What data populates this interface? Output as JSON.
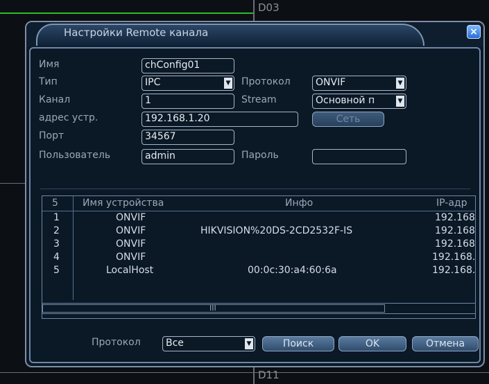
{
  "background": {
    "top_label": "D03",
    "bottom_label": "D11"
  },
  "dialog": {
    "title": "Настройки Remote канала",
    "close_glyph": "×"
  },
  "form": {
    "name_label": "Имя",
    "name_value": "chConfig01",
    "type_label": "Тип",
    "type_value": "IPC",
    "protocol_label": "Протокол",
    "protocol_value": "ONVIF",
    "channel_label": "Канал",
    "channel_value": "1",
    "stream_label": "Stream",
    "stream_value": "Основной п",
    "address_label": "адрес устр.",
    "address_value": "192.168.1.20",
    "network_button": "Сеть",
    "port_label": "Порт",
    "port_value": "34567",
    "user_label": "Пользователь",
    "user_value": "admin",
    "password_label": "Пароль",
    "password_value": ""
  },
  "device_list": {
    "headers": {
      "count": "5",
      "device_name": "Имя устройства",
      "info": "Инфо",
      "ip": "IP-адр"
    },
    "rows": [
      {
        "num": "1",
        "name": "ONVIF",
        "info": "",
        "ip": "192.168"
      },
      {
        "num": "2",
        "name": "ONVIF",
        "info": "HIKVISION%20DS-2CD2532F-IS",
        "ip": "192.168"
      },
      {
        "num": "3",
        "name": "ONVIF",
        "info": "",
        "ip": "192.168"
      },
      {
        "num": "4",
        "name": "ONVIF",
        "info": "",
        "ip": "192.168."
      },
      {
        "num": "5",
        "name": "LocalHost",
        "info": "00:0c:30:a4:60:6a",
        "ip": "192.168."
      }
    ],
    "scroll_grip": "III"
  },
  "footer": {
    "protocol_label": "Протокол",
    "protocol_value": "Все",
    "search_button": "Поиск",
    "ok_button": "OK",
    "cancel_button": "Отмена"
  },
  "colors": {
    "accent": "#2a6fd4",
    "text": "#d6dee8",
    "label": "#9aa8b8"
  }
}
